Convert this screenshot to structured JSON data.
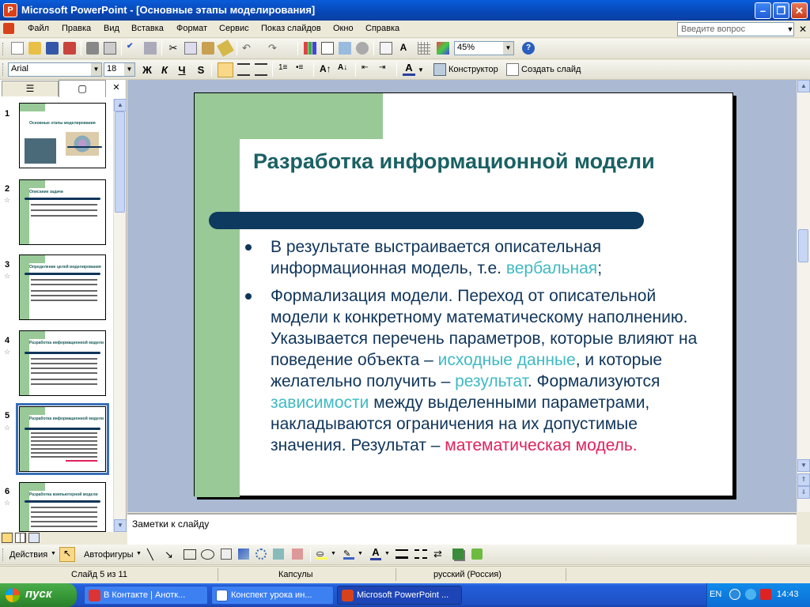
{
  "window": {
    "title": "Microsoft PowerPoint - [Основные этапы моделирования]",
    "app_icon": "P"
  },
  "menu": {
    "items": [
      "Файл",
      "Правка",
      "Вид",
      "Вставка",
      "Формат",
      "Сервис",
      "Показ слайдов",
      "Окно",
      "Справка"
    ],
    "help_placeholder": "Введите вопрос"
  },
  "toolbar": {
    "zoom": "45%"
  },
  "format_toolbar": {
    "font": "Arial",
    "size": "18",
    "bold": "Ж",
    "italic": "К",
    "underline": "Ч",
    "shadow": "S",
    "designer": "Конструктор",
    "new_slide": "Создать слайд"
  },
  "slides_panel": {
    "slides": [
      {
        "num": "1",
        "title": "Основные этапы моделирования"
      },
      {
        "num": "2",
        "title": "Описание задачи"
      },
      {
        "num": "3",
        "title": "Определение целей моделирования"
      },
      {
        "num": "4",
        "title": "Разработка информационной модели"
      },
      {
        "num": "5",
        "title": "Разработка информационной модели"
      },
      {
        "num": "6",
        "title": "Разработка компьютерной модели"
      }
    ]
  },
  "slide": {
    "title": "Разработка информационной модели",
    "b1_a": "В результате выстраивается описательная информационная модель, т.е. ",
    "b1_hl": "вербальная",
    "b1_end": ";",
    "b2_a": "Формализация модели. Переход от описательной модели к конкретному математическому наполнению. Указывается перечень параметров, которые влияют на поведение объекта – ",
    "b2_hl1": "исходные данные",
    "b2_b": ", и которые желательно получить – ",
    "b2_hl2": "результат",
    "b2_c": ". Формализуются ",
    "b2_hl3": "зависимости",
    "b2_d": " между выделенными параметрами, накладываются ограничения на их допустимые значения. Результат – ",
    "b2_hl4": "математическая модель",
    "b2_end": "."
  },
  "notes": {
    "label": "Заметки к слайду"
  },
  "drawing_toolbar": {
    "actions": "Действия",
    "autoshapes": "Автофигуры"
  },
  "status": {
    "slide": "Слайд 5 из 11",
    "template": "Капсулы",
    "language": "русский (Россия)"
  },
  "taskbar": {
    "start": "пуск",
    "tasks": [
      "В Контакте | Анотк...",
      "Конспект урока ин...",
      "Microsoft PowerPoint ..."
    ],
    "lang": "EN",
    "time": "14:43"
  },
  "colors": {
    "accent_green": "#98c997",
    "title_teal": "#1a6163",
    "navy": "#10355a",
    "highlight_teal": "#3fbac2",
    "highlight_pink": "#e0215c"
  }
}
